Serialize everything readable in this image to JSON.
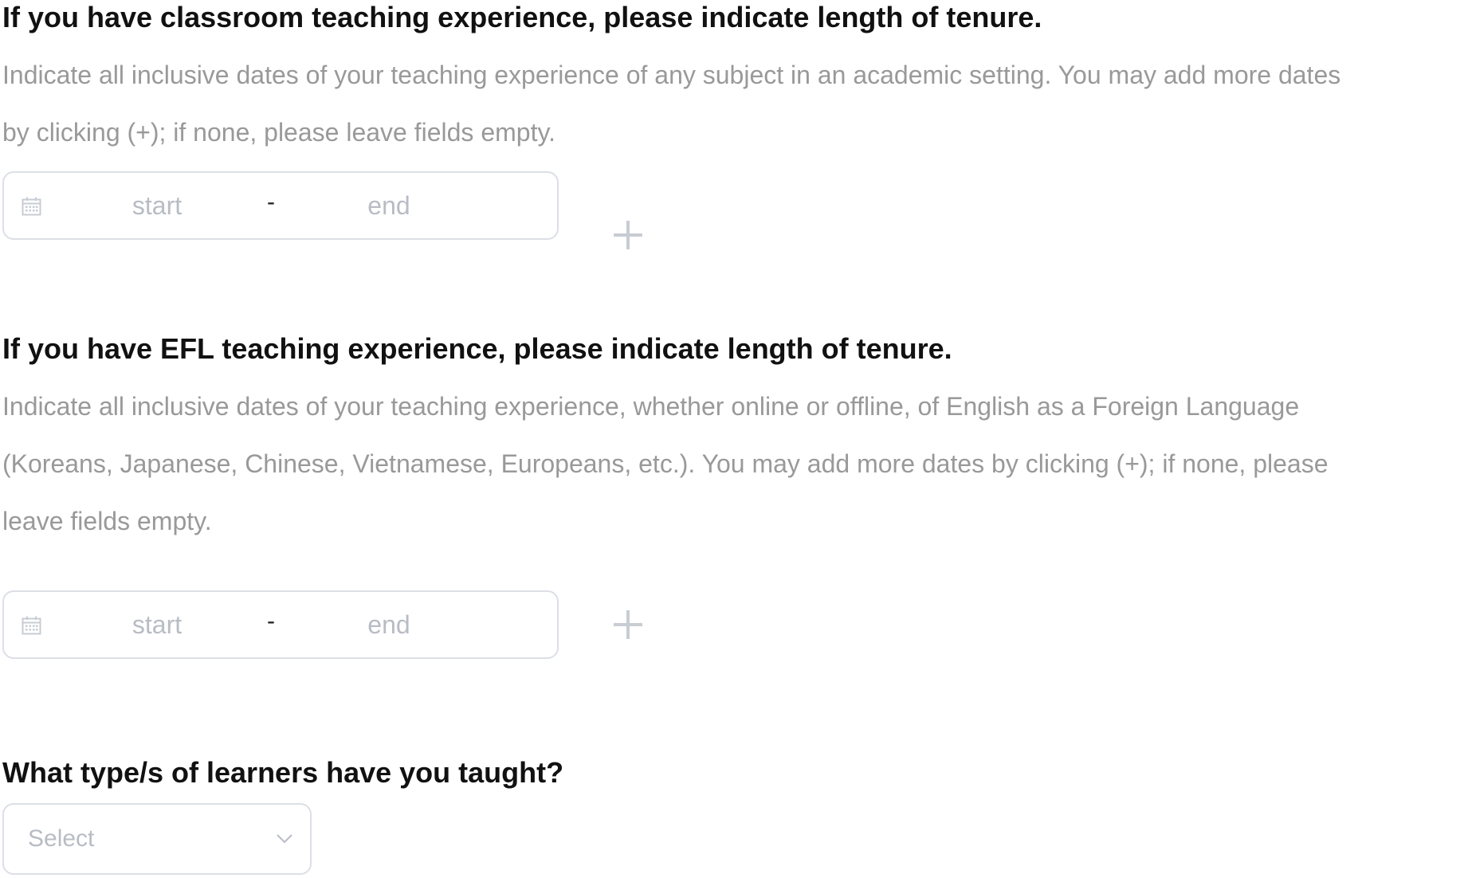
{
  "questions": [
    {
      "title": "If you have classroom teaching experience, please indicate length of tenure.",
      "description_lines": [
        "Indicate all inclusive dates of your teaching experience of any subject in an academic setting. You may add more dates",
        "by clicking (+); if none, please leave fields empty."
      ],
      "range": {
        "start_placeholder": "start",
        "separator": "-",
        "end_placeholder": "end",
        "icon": "calendar-icon"
      },
      "add_icon": "plus-icon"
    },
    {
      "title": "If you have EFL teaching experience, please indicate length of tenure.",
      "description_lines": [
        "Indicate all inclusive dates of your teaching experience, whether online or offline, of English as a Foreign Language",
        "(Koreans, Japanese, Chinese, Vietnamese, Europeans, etc.). You may add more dates by clicking (+); if none, please",
        "leave fields empty."
      ],
      "range": {
        "start_placeholder": "start",
        "separator": "-",
        "end_placeholder": "end",
        "icon": "calendar-icon"
      },
      "add_icon": "plus-icon"
    },
    {
      "title": "What type/s of learners have you taught?",
      "select": {
        "placeholder": "Select",
        "icon": "chevron-down-icon"
      }
    }
  ],
  "colors": {
    "title": "#111111",
    "description": "#999999",
    "placeholder": "#b8bcc4",
    "border": "#dcdfe6",
    "icon": "#c8ccd3"
  }
}
